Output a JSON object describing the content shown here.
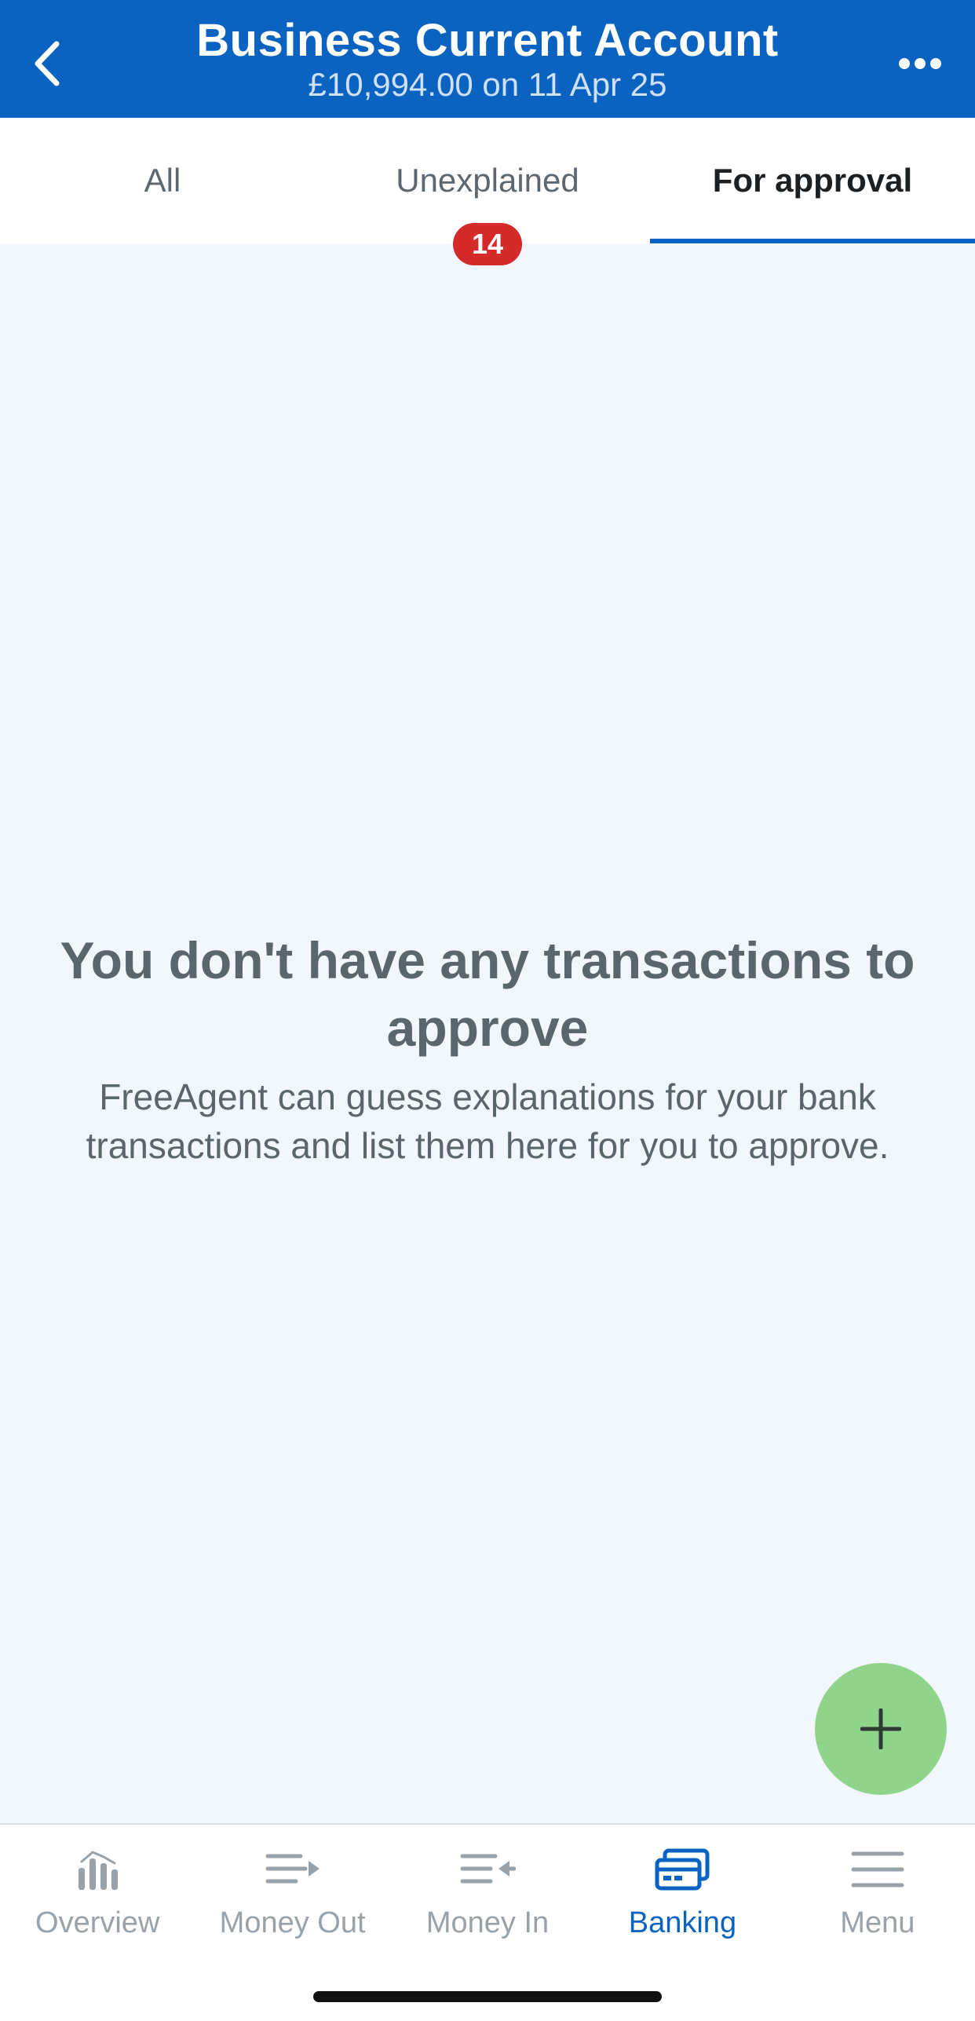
{
  "header": {
    "title": "Business Current Account",
    "subtitle": "£10,994.00 on 11 Apr 25",
    "back_icon": "chevron-left-icon",
    "more_icon": "more-horizontal-icon",
    "color": "#0a63c0"
  },
  "tabs": [
    {
      "label": "All",
      "active": false
    },
    {
      "label": "Unexplained",
      "badge": "14",
      "active": false
    },
    {
      "label": "For approval",
      "active": true
    }
  ],
  "empty_state": {
    "title": "You don't have any transactions to approve",
    "description": "FreeAgent can guess explanations for your bank transactions and list them here for you to approve."
  },
  "fab": {
    "icon": "plus-icon",
    "color": "#8fd48a"
  },
  "bottom_nav": {
    "items": [
      {
        "label": "Overview",
        "icon": "bar-chart-icon",
        "active": false
      },
      {
        "label": "Money Out",
        "icon": "money-out-icon",
        "active": false
      },
      {
        "label": "Money In",
        "icon": "money-in-icon",
        "active": false
      },
      {
        "label": "Banking",
        "icon": "bank-card-icon",
        "active": true
      },
      {
        "label": "Menu",
        "icon": "hamburger-menu-icon",
        "active": false
      }
    ]
  }
}
